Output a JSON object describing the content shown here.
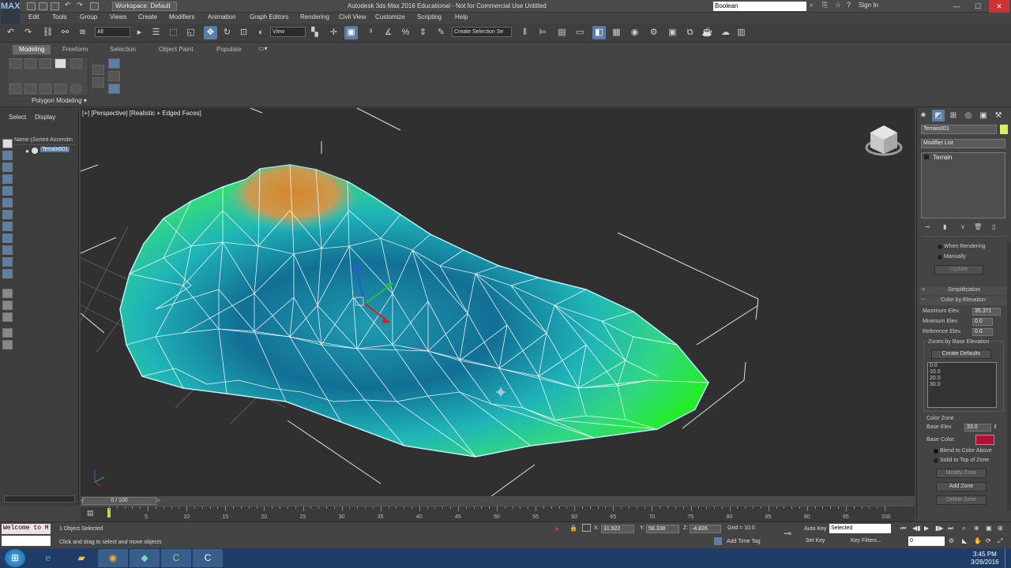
{
  "title_bar": {
    "workspace": "Workspace: Default",
    "window_title": "Autodesk 3ds Max 2016 Educational - Not for Commercial Use    Untitled",
    "search_value": "Boolean",
    "sign_in": "Sign In",
    "app_logo": "MAX"
  },
  "menu": [
    "Edit",
    "Tools",
    "Group",
    "Views",
    "Create",
    "Modifiers",
    "Animation",
    "Graph Editors",
    "Rendering",
    "Civil View",
    "Customize",
    "Scripting",
    "Help"
  ],
  "toolbar": {
    "selection_filter": "All",
    "ref_coord": "View",
    "named_selection": "Create Selection Se"
  },
  "ribbon": {
    "tabs": [
      "Modeling",
      "Freeform",
      "Selection",
      "Object Paint",
      "Populate"
    ],
    "panel_label": "Polygon Modeling"
  },
  "scene_explorer": {
    "tabs": [
      "Select",
      "Display"
    ],
    "column_header": "Name (Sorted Ascendin",
    "items": [
      "Terrain001"
    ]
  },
  "viewport": {
    "label": "[+] [Perspective] [Realistic + Edged Faces]"
  },
  "command_panel": {
    "object_name": "Terrain001",
    "object_color": "#d8f05a",
    "modifier_list": "Modifier List",
    "stack_item": "Terrain",
    "update_options": [
      "When Rendering",
      "Manually"
    ],
    "update_button": "Update",
    "rollouts": [
      "Simplification",
      "Color by Elevation"
    ],
    "max_elev_label": "Maximum Elev.",
    "max_elev": "35.371",
    "min_elev_label": "Minimum Elev.",
    "min_elev": "0.0",
    "ref_elev_label": "Reference Elev.",
    "ref_elev": "0.0",
    "zones_title": "Zones by Base Elevation",
    "create_defaults": "Create Defaults",
    "zones": [
      "0.0",
      "10.0",
      "20.0",
      "30.0"
    ],
    "color_zone_title": "Color Zone",
    "base_elev_label": "Base Elev.",
    "base_elev": "33.0",
    "base_color_label": "Base Color:",
    "base_color": "#b0103a",
    "blend_options": [
      "Blend to Color Above",
      "Solid to Top of Zone"
    ],
    "zone_buttons": [
      "Modify Zone",
      "Add Zone",
      "Delete Zone"
    ]
  },
  "timeline": {
    "frame": "0 / 100",
    "ticks": [
      "5",
      "10",
      "15",
      "20",
      "25",
      "30",
      "35",
      "40",
      "45",
      "50",
      "55",
      "60",
      "65",
      "70",
      "75",
      "80",
      "85",
      "90",
      "95",
      "100"
    ]
  },
  "status": {
    "maxscript": "Welcome to M",
    "selected": "1 Object Selected",
    "prompt": "Click and drag to select and move objects",
    "x_label": "X:",
    "x": "31.922",
    "y_label": "Y:",
    "y": "58.338",
    "z_label": "Z:",
    "z": "-4.826",
    "grid": "Grid = 10.0",
    "add_time_tag": "Add Time Tag",
    "auto_key": "Auto Key",
    "set_key": "Set Key",
    "key_mode": "Selected",
    "key_filters": "Key Filters...",
    "current_frame": "0"
  },
  "taskbar": {
    "time": "3:45 PM",
    "date": "3/26/2016"
  },
  "colors": {
    "terrain_low": "#1e7fa0",
    "terrain_mid": "#29d6c8",
    "terrain_edge": "#22ee22",
    "terrain_peak": "#d8862a",
    "accent": "#5a7ea6"
  }
}
